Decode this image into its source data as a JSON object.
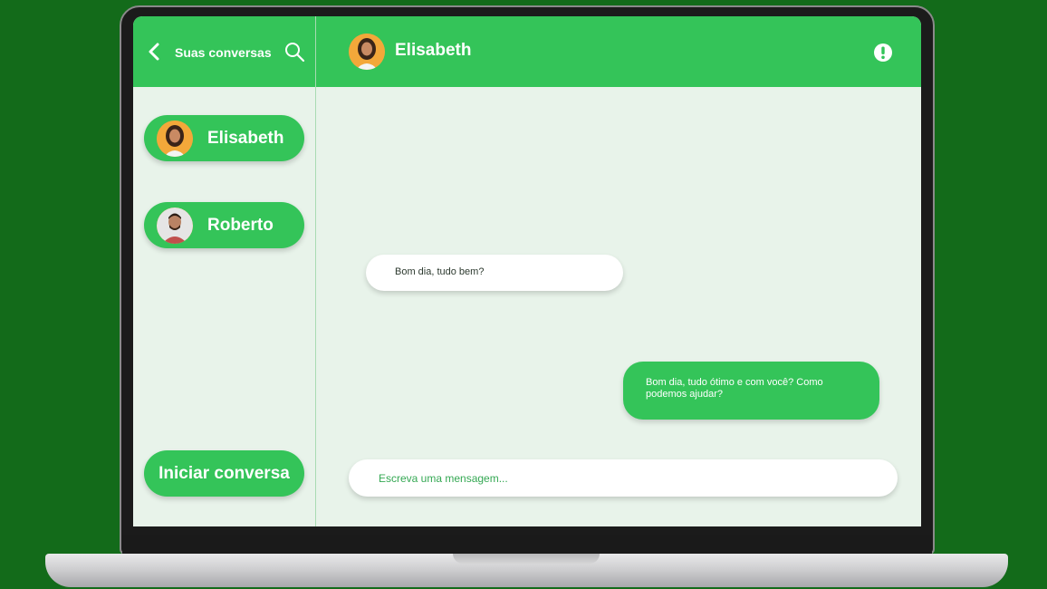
{
  "header": {
    "title": "Suas conversas",
    "contact_name": "Elisabeth"
  },
  "sidebar": {
    "contacts": [
      {
        "name": "Elisabeth",
        "avatar": "woman-avatar"
      },
      {
        "name": "Roberto",
        "avatar": "man-avatar"
      }
    ],
    "start_button": "Iniciar conversa"
  },
  "chat": {
    "messages": [
      {
        "direction": "incoming",
        "text": "Bom dia, tudo bem?"
      },
      {
        "direction": "outgoing",
        "text": "Bom dia, tudo ótimo e com você? Como podemos ajudar?"
      }
    ],
    "input_placeholder": "Escreva uma mensagem..."
  },
  "colors": {
    "background": "#136b1a",
    "accent": "#34c459",
    "chat_bg": "#e8f3ea"
  }
}
